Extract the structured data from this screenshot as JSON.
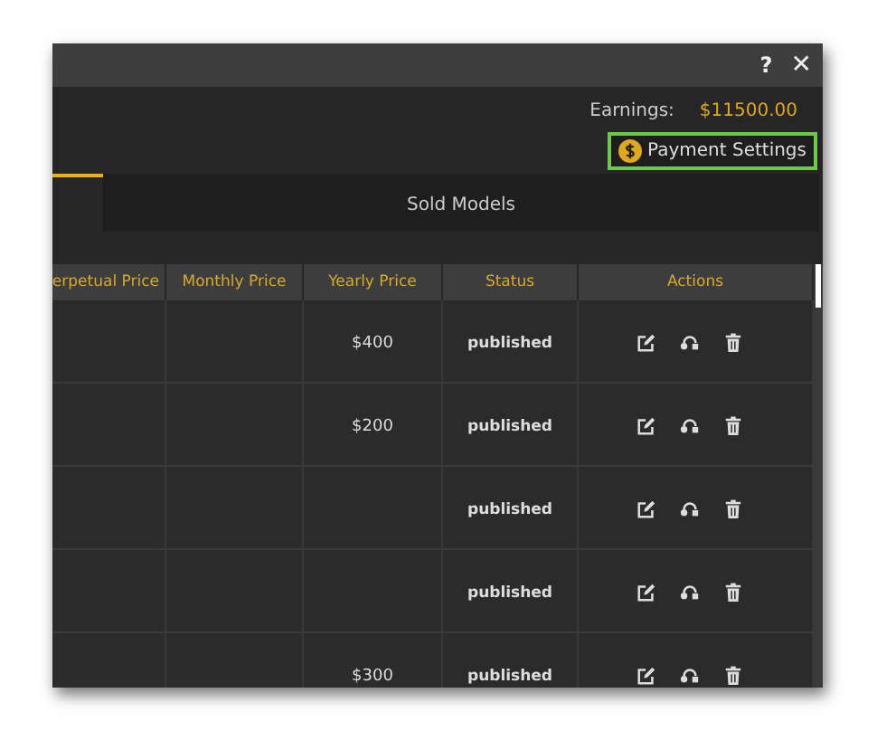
{
  "title_bar": {
    "help": "?",
    "close": "✕"
  },
  "earnings": {
    "label": "Earnings:",
    "value": "$11500.00"
  },
  "payment_settings": {
    "label": "Payment Settings",
    "focused": true
  },
  "tabs": [
    {
      "selected": true
    },
    {
      "label": "Sold Models",
      "selected": false
    }
  ],
  "table": {
    "columns": [
      "erpetual Price",
      "Monthly Price",
      "Yearly Price",
      "Status",
      "Actions"
    ],
    "rows": [
      {
        "yearly_price": "$400",
        "status": "published"
      },
      {
        "yearly_price": "$200",
        "status": "published"
      },
      {
        "status": "published"
      },
      {
        "status": "published"
      },
      {
        "yearly_price": "$300",
        "status": "published"
      }
    ]
  }
}
